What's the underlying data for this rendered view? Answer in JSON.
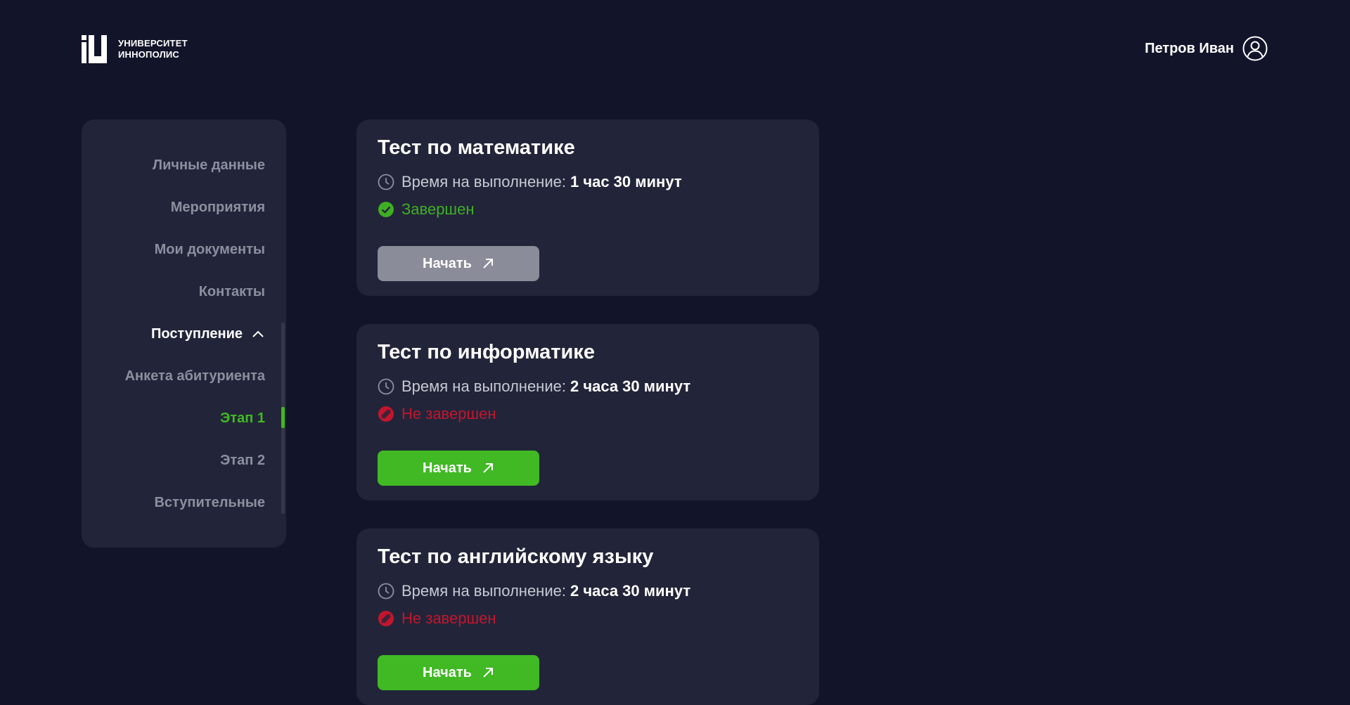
{
  "header": {
    "logo_line1": "УНИВЕРСИТЕТ",
    "logo_line2": "ИННОПОЛИС",
    "user_name": "Петров Иван"
  },
  "sidebar": {
    "items": [
      {
        "label": "Личные данные",
        "state": "normal"
      },
      {
        "label": "Мероприятия",
        "state": "normal"
      },
      {
        "label": "Мои документы",
        "state": "normal"
      },
      {
        "label": "Контакты",
        "state": "normal"
      },
      {
        "label": "Поступление",
        "state": "expanded"
      },
      {
        "label": "Анкета абитуриента",
        "state": "normal"
      },
      {
        "label": "Этап 1",
        "state": "active"
      },
      {
        "label": "Этап 2",
        "state": "normal"
      },
      {
        "label": "Вступительные",
        "state": "normal"
      }
    ]
  },
  "tests": [
    {
      "title": "Тест по математике",
      "time_label": "Время на выполнение:",
      "time_value": "1 час 30 минут",
      "status": "Завершен",
      "status_type": "done",
      "button_label": "Начать",
      "button_enabled": false
    },
    {
      "title": "Тест по информатике",
      "time_label": "Время на выполнение:",
      "time_value": "2 часа 30 минут",
      "status": "Не завершен",
      "status_type": "notdone",
      "button_label": "Начать",
      "button_enabled": true
    },
    {
      "title": "Тест по английскому языку",
      "time_label": "Время на выполнение:",
      "time_value": "2 часа 30 минут",
      "status": "Не завершен",
      "status_type": "notdone",
      "button_label": "Начать",
      "button_enabled": true
    }
  ],
  "colors": {
    "background": "#12152a",
    "panel": "#222539",
    "accent_green": "#40b924",
    "status_done": "#3fae24",
    "status_notdone": "#c3162e",
    "button_disabled": "#8a8c99",
    "muted_text": "#8c8f9f"
  },
  "icons": {
    "time": "clock-icon",
    "done": "check-circle-icon",
    "notdone": "crossed-circle-icon",
    "button": "arrow-up-right-icon",
    "user": "user-circle-icon",
    "expand": "chevron-up-icon"
  }
}
